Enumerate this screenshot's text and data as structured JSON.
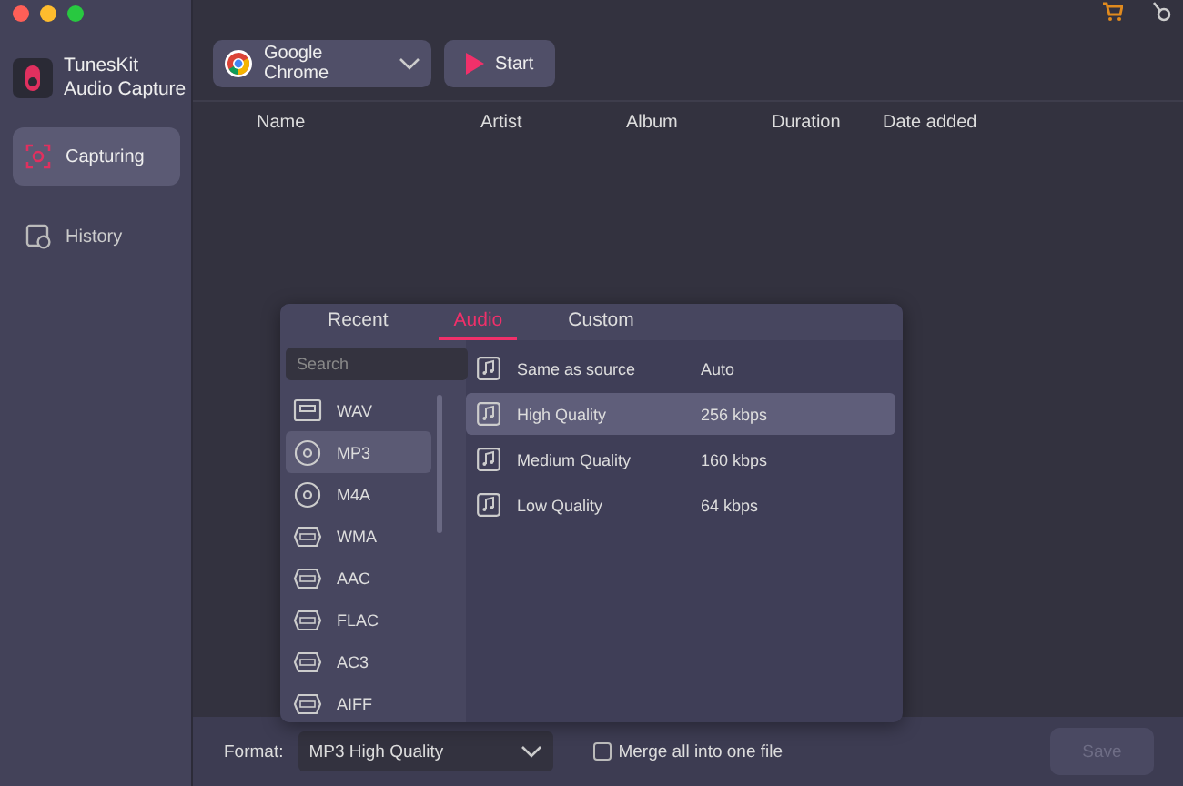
{
  "window": {
    "controls": [
      {
        "color": "#fe5f57"
      },
      {
        "color": "#febc2e"
      },
      {
        "color": "#28c840"
      }
    ]
  },
  "app": {
    "name": "TunesKit\nAudio Capture"
  },
  "sidebar": {
    "items": [
      {
        "label": "Capturing",
        "selected": true
      },
      {
        "label": "History",
        "selected": false
      }
    ]
  },
  "toolbar": {
    "source": "Google Chrome",
    "start": "Start"
  },
  "table": {
    "columns": [
      "Name",
      "Artist",
      "Album",
      "Duration",
      "Date added"
    ]
  },
  "format_popup": {
    "tabs": [
      {
        "label": "Recent",
        "selected": false
      },
      {
        "label": "Audio",
        "selected": true
      },
      {
        "label": "Custom",
        "selected": false
      }
    ],
    "search": {
      "placeholder": "Search"
    },
    "formats": [
      {
        "label": "WAV",
        "kind": "tape",
        "selected": false
      },
      {
        "label": "MP3",
        "kind": "disc",
        "selected": true
      },
      {
        "label": "M4A",
        "kind": "disc",
        "selected": false
      },
      {
        "label": "WMA",
        "kind": "badge",
        "selected": false
      },
      {
        "label": "AAC",
        "kind": "badge",
        "selected": false
      },
      {
        "label": "FLAC",
        "kind": "badge",
        "selected": false
      },
      {
        "label": "AC3",
        "kind": "badge",
        "selected": false
      },
      {
        "label": "AIFF",
        "kind": "badge",
        "selected": false
      }
    ],
    "qualities": [
      {
        "name": "Same as source",
        "bitrate": "Auto",
        "selected": false
      },
      {
        "name": "High Quality",
        "bitrate": "256 kbps",
        "selected": true
      },
      {
        "name": "Medium Quality",
        "bitrate": "160 kbps",
        "selected": false
      },
      {
        "name": "Low Quality",
        "bitrate": "64 kbps",
        "selected": false
      }
    ]
  },
  "bottom_bar": {
    "format_label": "Format:",
    "format_value": "MP3 High Quality",
    "merge": {
      "label": "Merge all into one file",
      "checked": false
    },
    "save": {
      "label": "Save",
      "disabled": true
    }
  }
}
